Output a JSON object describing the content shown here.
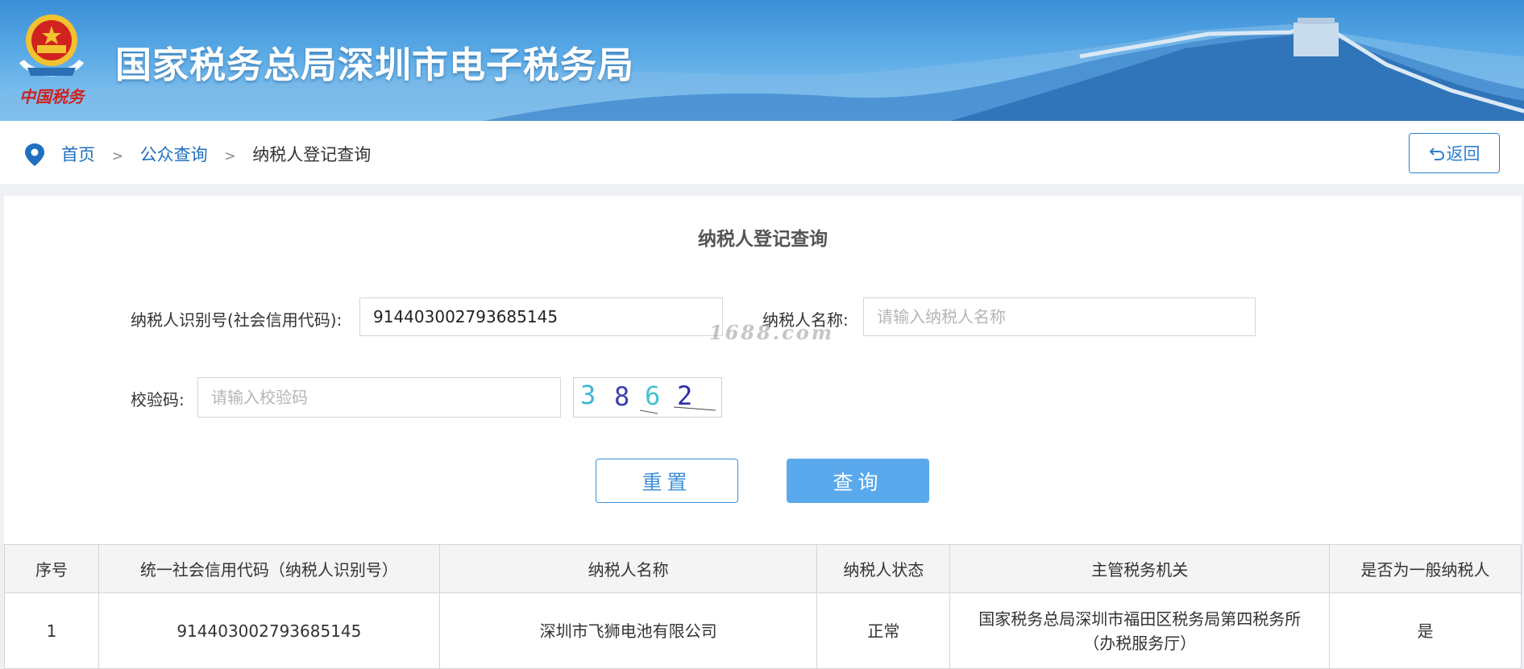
{
  "header": {
    "site_title": "国家税务总局深圳市电子税务局",
    "emblem_caption": "中国税务"
  },
  "breadcrumb": {
    "items": [
      "首页",
      "公众查询",
      "纳税人登记查询"
    ],
    "separator": ">",
    "back_label": "返回"
  },
  "form": {
    "title": "纳税人登记查询",
    "taxpayer_id": {
      "label": "纳税人识别号(社会信用代码):",
      "value": "914403002793685145"
    },
    "taxpayer_name": {
      "label": "纳税人名称:",
      "placeholder": "请输入纳税人名称",
      "value": ""
    },
    "captcha": {
      "label": "校验码:",
      "placeholder": "请输入校验码",
      "value": "",
      "image_text": "3862"
    },
    "reset_label": "重置",
    "query_label": "查询"
  },
  "watermark": "1688.com",
  "results": {
    "columns": [
      "序号",
      "统一社会信用代码（纳税人识别号）",
      "纳税人名称",
      "纳税人状态",
      "主管税务机关",
      "是否为一般纳税人"
    ],
    "rows": [
      {
        "index": "1",
        "credit_code": "914403002793685145",
        "name": "深圳市飞狮电池有限公司",
        "status": "正常",
        "authority_line1": "国家税务总局深圳市福田区税务局第四税务所",
        "authority_line2": "（办税服务厅）",
        "general_taxpayer": "是"
      }
    ]
  },
  "colors": {
    "banner_top": "#3c8fd6",
    "link": "#1f6fbf",
    "primary_button": "#5aa9ec",
    "emblem_red": "#d0221f",
    "emblem_gold": "#f2c230"
  }
}
